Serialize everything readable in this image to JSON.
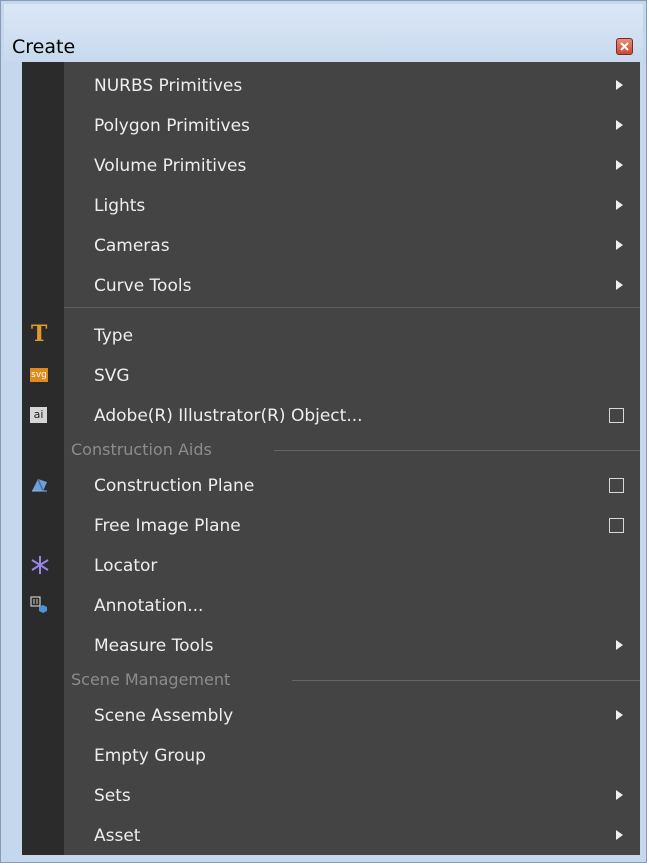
{
  "window": {
    "title": "Create"
  },
  "menu": {
    "items_top": [
      {
        "label": "NURBS Primitives",
        "submenu": true
      },
      {
        "label": "Polygon Primitives",
        "submenu": true
      },
      {
        "label": "Volume Primitives",
        "submenu": true
      },
      {
        "label": "Lights",
        "submenu": true
      },
      {
        "label": "Cameras",
        "submenu": true
      },
      {
        "label": "Curve Tools",
        "submenu": true
      }
    ],
    "items_type": [
      {
        "label": "Type",
        "icon": "type-t-icon"
      },
      {
        "label": "SVG",
        "icon": "svg-icon"
      },
      {
        "label": "Adobe(R) Illustrator(R) Object...",
        "icon": "illustrator-ai-icon",
        "option_box": true
      }
    ],
    "construction_aids": {
      "header": "Construction Aids",
      "items": [
        {
          "label": "Construction Plane",
          "icon": "construction-plane-icon",
          "option_box": true
        },
        {
          "label": "Free Image Plane",
          "option_box": true
        },
        {
          "label": "Locator",
          "icon": "locator-icon"
        },
        {
          "label": "Annotation...",
          "icon": "annotation-icon"
        },
        {
          "label": "Measure Tools",
          "submenu": true
        }
      ]
    },
    "scene_management": {
      "header": "Scene Management",
      "items": [
        {
          "label": "Scene Assembly",
          "submenu": true
        },
        {
          "label": "Empty Group"
        },
        {
          "label": "Sets",
          "submenu": true
        },
        {
          "label": "Asset",
          "submenu": true
        }
      ]
    },
    "icon_glyphs": {
      "type": "T",
      "svg": "svg",
      "ai": "ai"
    }
  },
  "colors": {
    "menu_bg": "#444444",
    "gutter_bg": "#2b2b2b",
    "text": "#eeeeee",
    "section_text": "#8c8c8c",
    "title_bg": "#c8d9ed",
    "type_icon": "#e29a2a",
    "locator_icon": "#9a86e8",
    "plane_icon": "#6fa0d8"
  }
}
